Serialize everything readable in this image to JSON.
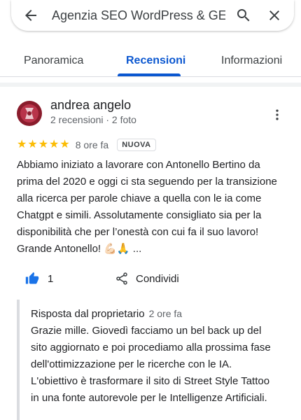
{
  "search": {
    "query": "Agenzia SEO WordPress & GE"
  },
  "tabs": [
    {
      "label": "Panoramica",
      "active": false
    },
    {
      "label": "Recensioni",
      "active": true
    },
    {
      "label": "Informazioni",
      "active": false
    }
  ],
  "review": {
    "reviewer_name": "andrea angelo",
    "reviewer_meta": "2 recensioni · 2 foto",
    "rating": 5,
    "time": "8 ore fa",
    "badge": "NUOVA",
    "text": "Abbiamo iniziato a lavorare con Antonello Bertino da prima del 2020 e oggi ci sta seguendo per la transizione alla ricerca per parole chiave a quella con le ia come Chatgpt e simili. Assolutamente consigliato sia per la disponibilità che per l’onestà con cui fa il suo lavoro! Grande Antonello! 💪🏻🙏 ...",
    "likes": "1",
    "share_label": "Condividi"
  },
  "owner_reply": {
    "title": "Risposta dal proprietario",
    "time": "2 ore fa",
    "text": "Grazie mille. Giovedì facciamo un bel back up del sito aggiornato e poi procediamo alla prossima fase dell'ottimizzazione per le ricerche con le IA. L'obiettivo è trasformare il sito di Street Style Tattoo in una fonte autorevole per le Intelligenze Artificiali."
  },
  "colors": {
    "accent": "#0b57d0",
    "star": "#fbbc04",
    "secondary_text": "#5f6368"
  },
  "icons": [
    "back-arrow-icon",
    "search-icon",
    "close-icon",
    "more-vert-icon",
    "thumb-up-icon",
    "share-icon"
  ]
}
